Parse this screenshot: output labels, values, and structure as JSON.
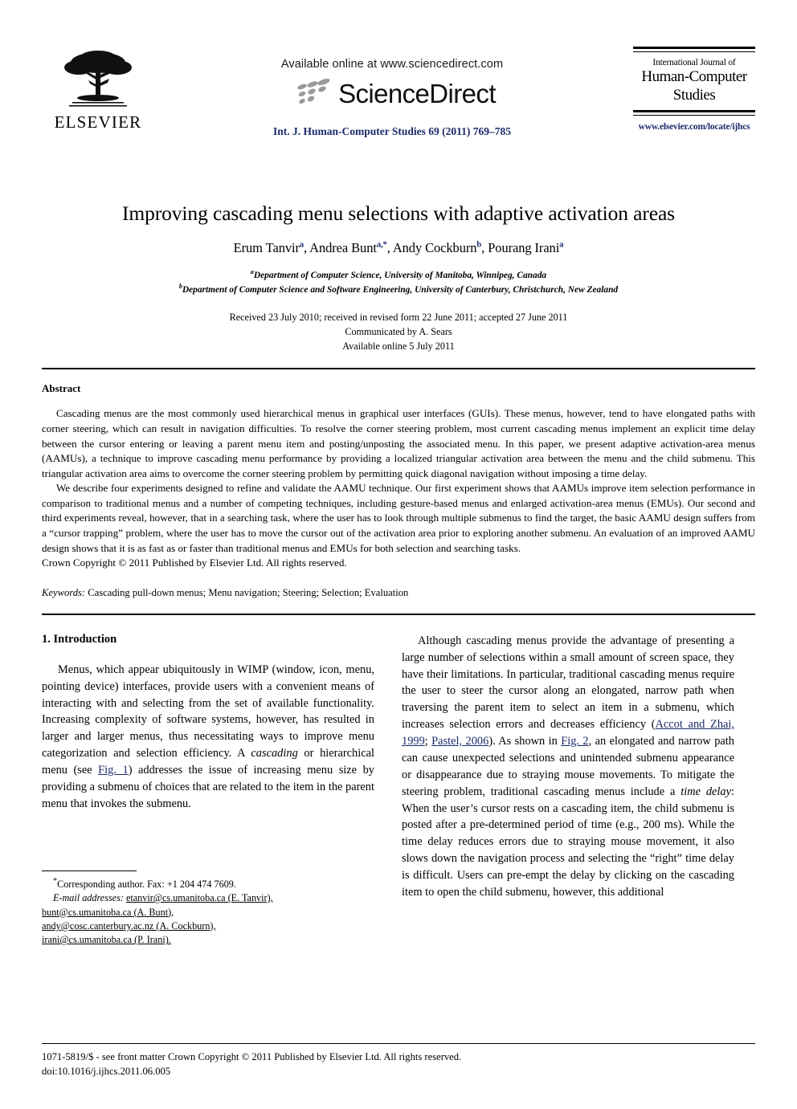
{
  "header": {
    "publisher_name": "ELSEVIER",
    "available_online": "Available online at www.sciencedirect.com",
    "sciencedirect_wordmark": "ScienceDirect",
    "journal_citation": "Int. J. Human-Computer Studies 69 (2011) 769–785",
    "journal_box": {
      "line1": "International Journal of",
      "line2": "Human-Computer",
      "line3": "Studies",
      "url": "www.elsevier.com/locate/ijhcs"
    }
  },
  "title_block": {
    "title": "Improving cascading menu selections with adaptive activation areas",
    "authors": [
      {
        "name": "Erum Tanvir",
        "sup": "a"
      },
      {
        "name": "Andrea Bunt",
        "sup": "a,*"
      },
      {
        "name": "Andy Cockburn",
        "sup": "b"
      },
      {
        "name": "Pourang Irani",
        "sup": "a"
      }
    ],
    "affiliations": [
      {
        "sup": "a",
        "text": "Department of Computer Science, University of Manitoba, Winnipeg, Canada"
      },
      {
        "sup": "b",
        "text": "Department of Computer Science and Software Engineering, University of Canterbury, Christchurch, New Zealand"
      }
    ],
    "dates": [
      "Received 23 July 2010; received in revised form 22 June 2011; accepted 27 June 2011",
      "Communicated by A. Sears",
      "Available online 5 July 2011"
    ]
  },
  "abstract": {
    "heading": "Abstract",
    "paragraph1": "Cascading menus are the most commonly used hierarchical menus in graphical user interfaces (GUIs). These menus, however, tend to have elongated paths with corner steering, which can result in navigation difficulties. To resolve the corner steering problem, most current cascading menus implement an explicit time delay between the cursor entering or leaving a parent menu item and posting/unposting the associated menu. In this paper, we present adaptive activation-area menus (AAMUs), a technique to improve cascading menu performance by providing a localized triangular activation area between the menu and the child submenu. This triangular activation area aims to overcome the corner steering problem by permitting quick diagonal navigation without imposing a time delay.",
    "paragraph2": "We describe four experiments designed to refine and validate the AAMU technique. Our first experiment shows that AAMUs improve item selection performance in comparison to traditional menus and a number of competing techniques, including gesture-based menus and enlarged activation-area menus (EMUs). Our second and third experiments reveal, however, that in a searching task, where the user has to look through multiple submenus to find the target, the basic AAMU design suffers from a “cursor trapping” problem, where the user has to move the cursor out of the activation area prior to exploring another submenu. An evaluation of an improved AAMU design shows that it is as fast as or faster than traditional menus and EMUs for both selection and searching tasks.",
    "copyright": "Crown Copyright © 2011 Published by Elsevier Ltd. All rights reserved."
  },
  "keywords": {
    "label": "Keywords:",
    "value": "Cascading pull-down menus; Menu navigation; Steering; Selection; Evaluation"
  },
  "body": {
    "section_heading": "1.  Introduction",
    "left_p1_a": "Menus, which appear ubiquitously in WIMP (window, icon, menu, pointing device) interfaces, provide users with a convenient means of interacting with and selecting from the set of available functionality. Increasing complexity of software systems, however, has resulted in larger and larger menus, thus necessitating ways to improve menu categorization and selection efficiency. A ",
    "left_p1_italic": "cascading",
    "left_p1_b": " or hierarchical menu (see ",
    "left_p1_link": "Fig. 1",
    "left_p1_c": ") addresses the issue of increasing menu size by providing a submenu of choices that are related to the item in the parent menu that invokes the submenu.",
    "right_p1_a": "Although cascading menus provide the advantage of presenting a large number of selections within a small amount of screen space, they have their limitations. In particular, traditional cascading menus require the user to steer the cursor along an elongated, narrow path when traversing the parent item to select an item in a submenu, which increases selection errors and decreases efficiency (",
    "right_link1": "Accot and Zhai, 1999",
    "right_p1_b": "; ",
    "right_link2": "Pastel, 2006",
    "right_p1_c": "). As shown in ",
    "right_link3": "Fig. 2",
    "right_p1_d": ", an elongated and narrow path can cause unexpected selections and unintended submenu appearance or disappearance due to straying mouse movements. To mitigate the steering problem, traditional cascading menus include a ",
    "right_p1_italic": "time delay",
    "right_p1_e": ": When the user’s cursor rests on a cascading item, the child submenu is posted after a pre-determined period of time (e.g., 200 ms). While the time delay reduces errors due to straying mouse movement, it also slows down the navigation process and selecting the “right” time delay is difficult. Users can pre-empt the delay by clicking on the cascading item to open the child submenu, however, this additional"
  },
  "footnotes": {
    "corresponding": "Corresponding author. Fax: +1 204 474 7609.",
    "corresponding_sup": "*",
    "email_label": "E-mail addresses:",
    "emails": [
      "etanvir@cs.umanitoba.ca (E. Tanvir),",
      "bunt@cs.umanitoba.ca (A. Bunt),",
      "andy@cosc.canterbury.ac.nz (A. Cockburn),",
      "irani@cs.umanitoba.ca (P. Irani)."
    ]
  },
  "page_footer": {
    "issn_line": "1071-5819/$ - see front matter Crown Copyright © 2011 Published by Elsevier Ltd. All rights reserved.",
    "doi_line": "doi:10.1016/j.ijhcs.2011.06.005"
  },
  "colors": {
    "link": "#1b2a6b",
    "text": "#000000",
    "background": "#ffffff"
  }
}
